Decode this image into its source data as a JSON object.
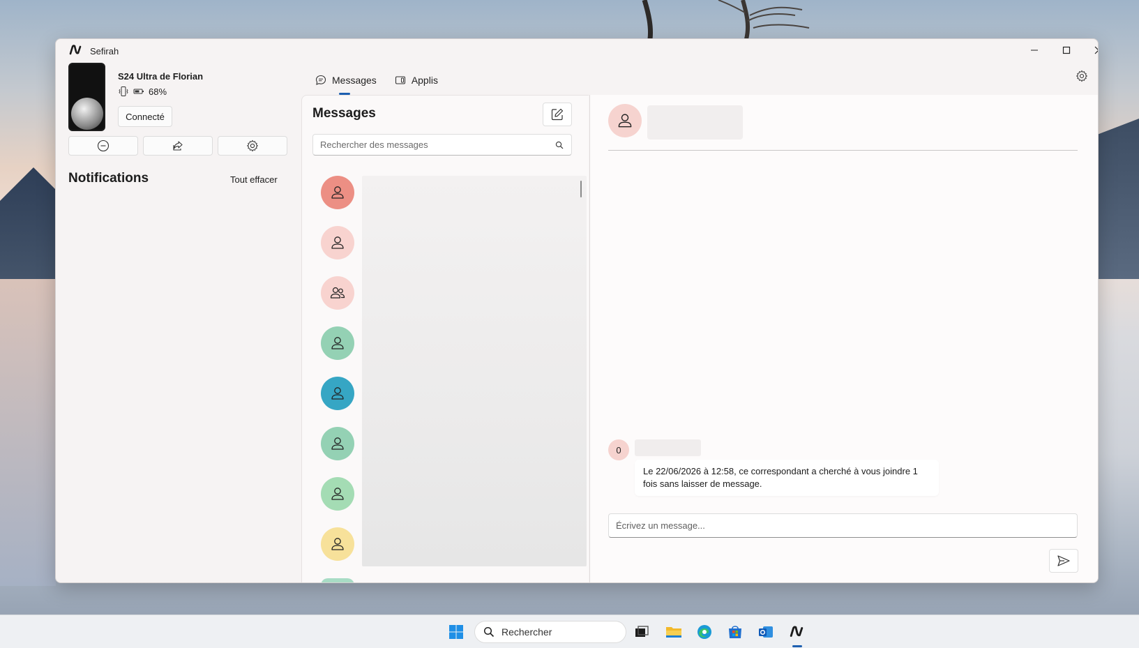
{
  "window": {
    "title": "Sefirah"
  },
  "device": {
    "name": "S24 Ultra de Florian",
    "battery": "68%",
    "connection_label": "Connecté"
  },
  "notifications": {
    "title": "Notifications",
    "clear_label": "Tout effacer"
  },
  "tabs": [
    {
      "label": "Messages",
      "active": true
    },
    {
      "label": "Applis",
      "active": false
    }
  ],
  "messages_panel": {
    "title": "Messages",
    "search_placeholder": "Rechercher des messages",
    "contacts": [
      {
        "color": "#ec8f84",
        "icon": "person-icon"
      },
      {
        "color": "#f8d3cf",
        "icon": "person-icon"
      },
      {
        "color": "#f8d3cf",
        "icon": "people-icon"
      },
      {
        "color": "#94d1b4",
        "icon": "person-icon"
      },
      {
        "color": "#36a6c4",
        "icon": "person-icon"
      },
      {
        "color": "#94d1b4",
        "icon": "person-icon"
      },
      {
        "color": "#a4dcb4",
        "icon": "person-icon"
      },
      {
        "color": "#f7e19a",
        "icon": "person-icon"
      }
    ]
  },
  "conversation": {
    "message_avatar_initial": "0",
    "call_notice": "Le 22/06/2026 à 12:58, ce correspondant a cherché à vous joindre 1 fois sans laisser de message.",
    "compose_placeholder": "Écrivez un message..."
  },
  "taskbar": {
    "search_label": "Rechercher"
  },
  "colors": {
    "accent": "#1d5fb0",
    "window_bg": "#f6f3f3"
  }
}
